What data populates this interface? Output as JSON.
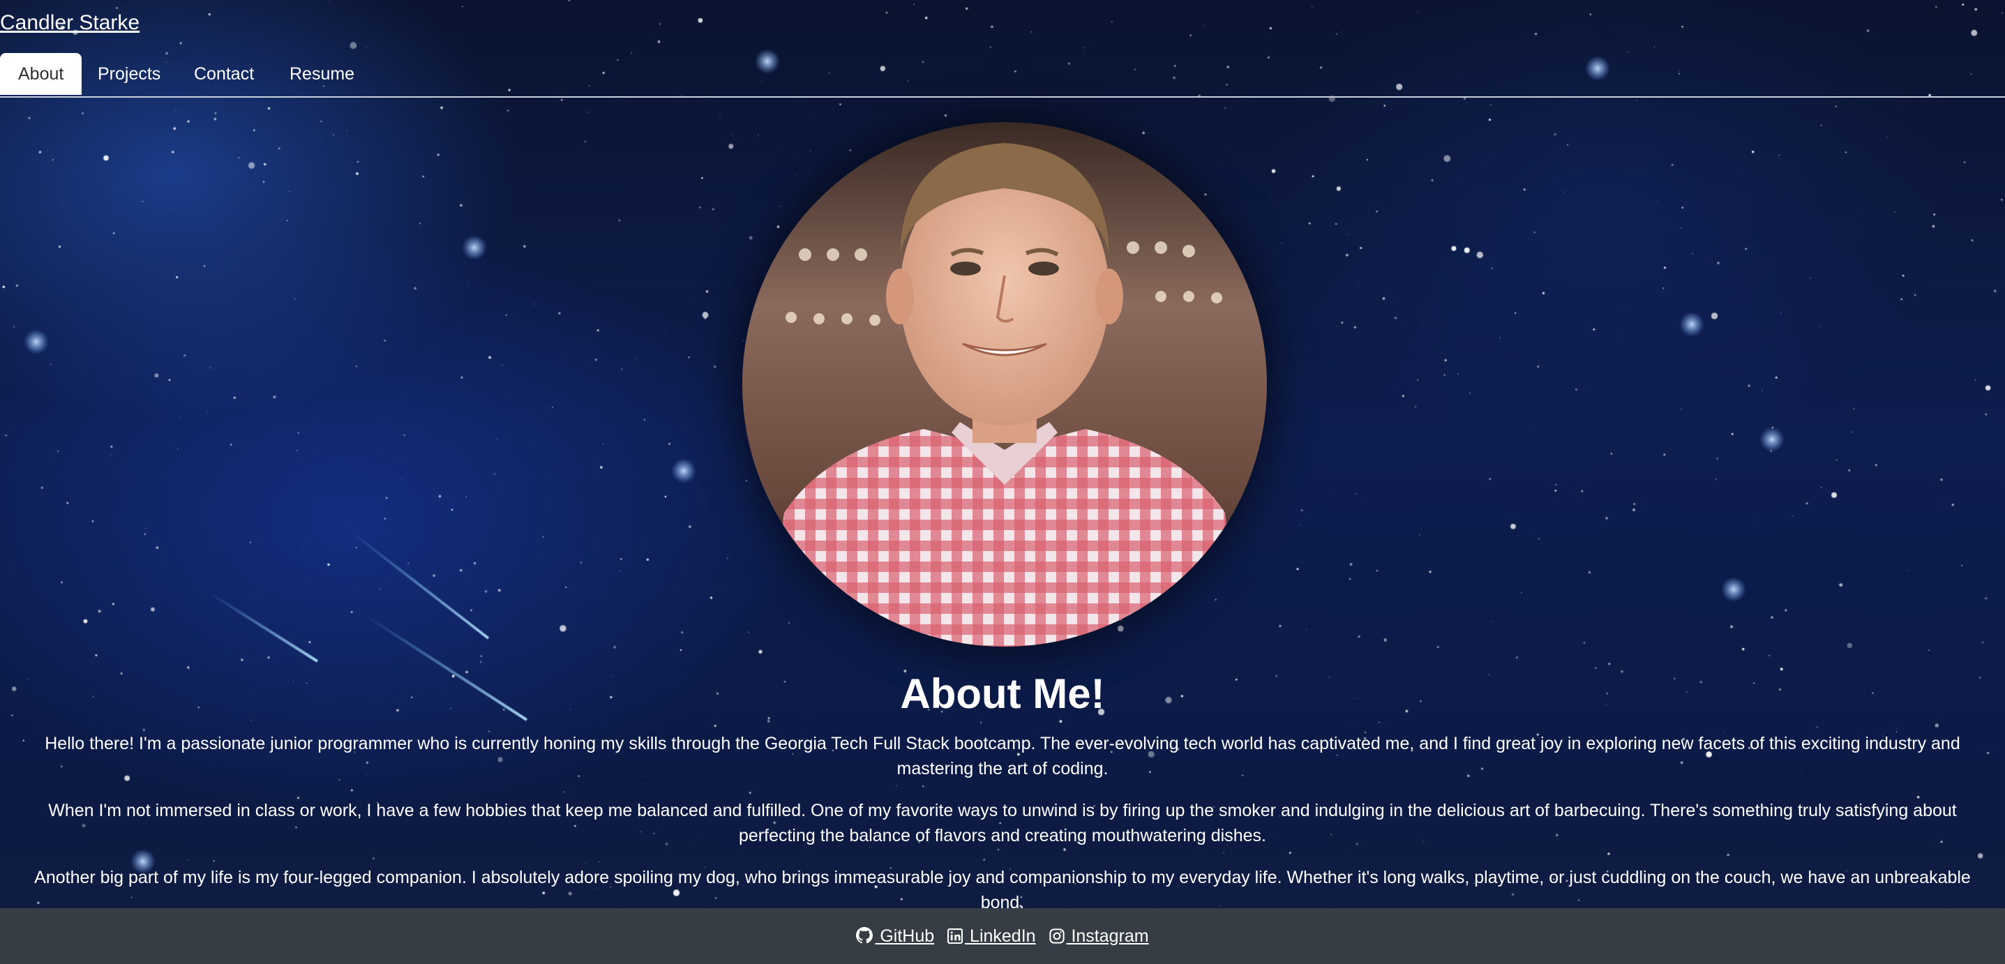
{
  "header": {
    "brand": "Candler Starke",
    "tabs": [
      {
        "label": "About",
        "active": true
      },
      {
        "label": "Projects",
        "active": false
      },
      {
        "label": "Contact",
        "active": false
      },
      {
        "label": "Resume",
        "active": false
      }
    ]
  },
  "main": {
    "heading": "About Me!",
    "paragraphs": [
      "Hello there! I'm a passionate junior programmer who is currently honing my skills through the Georgia Tech Full Stack bootcamp. The ever-evolving tech world has captivated me, and I find great joy in exploring new facets of this exciting industry and mastering the art of coding.",
      "When I'm not immersed in class or work, I have a few hobbies that keep me balanced and fulfilled. One of my favorite ways to unwind is by firing up the smoker and indulging in the delicious art of barbecuing. There's something truly satisfying about perfecting the balance of flavors and creating mouthwatering dishes.",
      "Another big part of my life is my four-legged companion. I absolutely adore spoiling my dog, who brings immeasurable joy and companionship to my everyday life. Whether it's long walks, playtime, or just cuddling on the couch, we have an unbreakable bond."
    ]
  },
  "footer": {
    "links": [
      {
        "label": " GitHub",
        "icon": "github-icon"
      },
      {
        "label": " LinkedIn",
        "icon": "linkedin-icon"
      },
      {
        "label": " Instagram",
        "icon": "instagram-icon"
      }
    ]
  },
  "colors": {
    "background": "#0d1d4e",
    "footer": "#363d44",
    "active_tab": "#ffffff",
    "text": "#ffffff"
  }
}
